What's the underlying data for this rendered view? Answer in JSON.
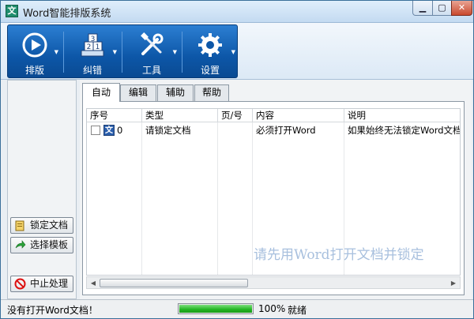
{
  "window": {
    "title": "Word智能排版系统",
    "controls": {
      "minimize": "0",
      "maximize": "1",
      "close": "r"
    }
  },
  "ribbon": {
    "buttons": [
      {
        "label": "排版",
        "icon": "play-icon"
      },
      {
        "label": "纠错",
        "icon": "numbered-blocks-icon"
      },
      {
        "label": "工具",
        "icon": "tools-icon"
      },
      {
        "label": "设置",
        "icon": "gear-icon"
      }
    ]
  },
  "sidebar": {
    "lock_label": "锁定文档",
    "template_label": "选择模板",
    "stop_label": "中止处理"
  },
  "tabs": [
    "自动",
    "编辑",
    "辅助",
    "帮助"
  ],
  "active_tab": "自动",
  "table": {
    "columns": [
      "序号",
      "类型",
      "页/号",
      "内容",
      "说明"
    ],
    "rows": [
      {
        "index": "0",
        "type": "请锁定文档",
        "page": "",
        "content": "必须打开Word",
        "note": "如果始终无法锁定Word文档"
      }
    ],
    "hint": "请先用Word打开文档并锁定"
  },
  "status": {
    "message": "没有打开Word文档！",
    "progress": 100,
    "progress_text": "100%",
    "state": "就绪"
  },
  "colors": {
    "ribbon_blue": "#0d57a8",
    "progress_green": "#22b422",
    "hint_text": "#a8c0de"
  }
}
